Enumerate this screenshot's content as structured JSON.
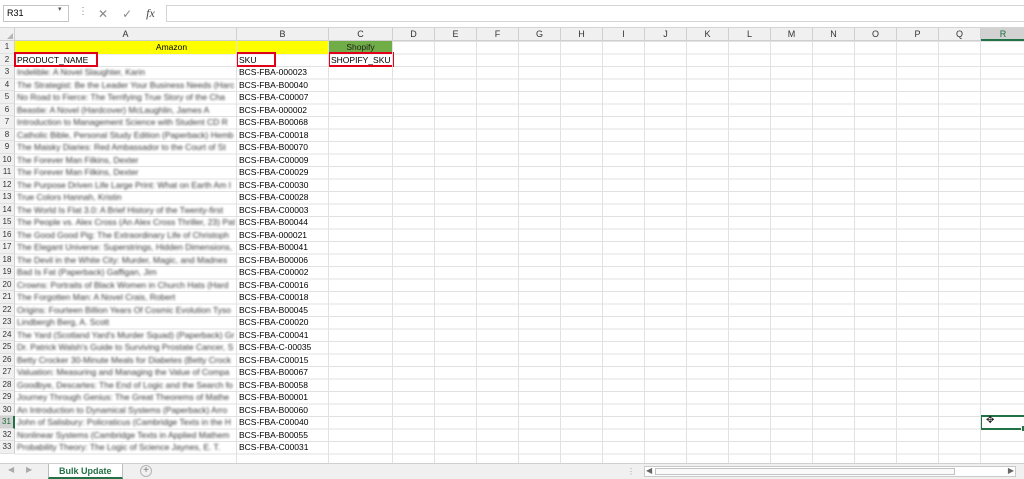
{
  "formula_bar": {
    "name_box": "R31",
    "formula_value": ""
  },
  "columns": [
    "A",
    "B",
    "C",
    "D",
    "E",
    "F",
    "G",
    "H",
    "I",
    "J",
    "K",
    "L",
    "M",
    "N",
    "O",
    "P",
    "Q",
    "R"
  ],
  "active_column": "R",
  "active_row": 31,
  "header_row": {
    "amazon_label": "Amazon",
    "shopify_label": "Shopify",
    "product_name_header": "PRODUCT_NAME",
    "sku_header": "SKU",
    "shopify_sku_header": "SHOPIFY_SKU"
  },
  "rows": [
    {
      "n": 3,
      "name": "Indelible: A Novel Slaughter, Karin",
      "sku": "BCS-FBA-000023"
    },
    {
      "n": 4,
      "name": "The Strategist: Be the Leader Your Business Needs (Harc",
      "sku": "BCS-FBA-B00040"
    },
    {
      "n": 5,
      "name": "No Road to Fierce: The Terrifying True Story of the Cha",
      "sku": "BCS-FBA-C00007"
    },
    {
      "n": 6,
      "name": "Beastie: A Novel (Hardcover) McLaughlin, James A",
      "sku": "BCS-FBA-000002"
    },
    {
      "n": 7,
      "name": "Introduction to Management Science with Student CD R",
      "sku": "BCS-FBA-B00068"
    },
    {
      "n": 8,
      "name": "Catholic Bible, Personal Study Edition (Paperback) Hemb",
      "sku": "BCS-FBA-C00018"
    },
    {
      "n": 9,
      "name": "The Maisky Diaries: Red Ambassador to the Court of St",
      "sku": "BCS-FBA-B00070"
    },
    {
      "n": 10,
      "name": "The Forever Man Filkins, Dexter",
      "sku": "BCS-FBA-C00009"
    },
    {
      "n": 11,
      "name": "The Forever Man Filkins, Dexter",
      "sku": "BCS-FBA-C00029"
    },
    {
      "n": 12,
      "name": "The Purpose Driven Life Large Print: What on Earth Am I",
      "sku": "BCS-FBA-C00030"
    },
    {
      "n": 13,
      "name": "True Colors Hannah, Kristin",
      "sku": "BCS-FBA-C00028"
    },
    {
      "n": 14,
      "name": "The World Is Flat 3.0: A Brief History of the Twenty-first",
      "sku": "BCS-FBA-C00003"
    },
    {
      "n": 15,
      "name": "The People vs. Alex Cross (An Alex Cross Thriller, 23) Pat",
      "sku": "BCS-FBA-B00044"
    },
    {
      "n": 16,
      "name": "The Good Good Pig: The Extraordinary Life of Christoph",
      "sku": "BCS-FBA-000021"
    },
    {
      "n": 17,
      "name": "The Elegant Universe: Superstrings, Hidden Dimensions,",
      "sku": "BCS-FBA-B00041"
    },
    {
      "n": 18,
      "name": "The Devil in the White City: Murder, Magic, and Madnes",
      "sku": "BCS-FBA-B00006"
    },
    {
      "n": 19,
      "name": "Bad Is Fat (Paperback) Gaffigan, Jim",
      "sku": "BCS-FBA-C00002"
    },
    {
      "n": 20,
      "name": "Crowns: Portraits of Black Women in Church Hats (Hard",
      "sku": "BCS-FBA-C00016"
    },
    {
      "n": 21,
      "name": "The Forgotten Man: A Novel Crais, Robert",
      "sku": "BCS-FBA-C00018"
    },
    {
      "n": 22,
      "name": "Origins: Fourteen Billion Years Of Cosmic Evolution Tyso",
      "sku": "BCS-FBA-B00045"
    },
    {
      "n": 23,
      "name": "Lindbergh Berg, A. Scott",
      "sku": "BCS-FBA-C00020"
    },
    {
      "n": 24,
      "name": "The Yard (Scotland Yard's Murder Squad) (Paperback) Gr",
      "sku": "BCS-FBA-C00041"
    },
    {
      "n": 25,
      "name": "Dr. Patrick Walsh's Guide to Surviving Prostate Cancer, S",
      "sku": "BCS-FBA-C-00035"
    },
    {
      "n": 26,
      "name": "Betty Crocker 30-Minute Meals for Diabetes (Betty Crock",
      "sku": "BCS-FBA-C00015"
    },
    {
      "n": 27,
      "name": "Valuation: Measuring and Managing the Value of Compa",
      "sku": "BCS-FBA-B00067"
    },
    {
      "n": 28,
      "name": "Goodbye, Descartes: The End of Logic and the Search fo",
      "sku": "BCS-FBA-B00058"
    },
    {
      "n": 29,
      "name": "Journey Through Genius: The Great Theorems of Mathe",
      "sku": "BCS-FBA-B00001"
    },
    {
      "n": 30,
      "name": "An Introduction to Dynamical Systems (Paperback) Arro",
      "sku": "BCS-FBA-B00060"
    },
    {
      "n": 31,
      "name": "John of Salisbury: Policraticus (Cambridge Texts in the H",
      "sku": "BCS-FBA-C00040"
    },
    {
      "n": 32,
      "name": "Nonlinear Systems (Cambridge Texts in Applied Mathem",
      "sku": "BCS-FBA-B00055"
    },
    {
      "n": 33,
      "name": "Probability Theory: The Logic of Science Jaynes, E. T.",
      "sku": "BCS-FBA-C00031"
    }
  ],
  "sheet_tab": "Bulk Update",
  "colors": {
    "amazon_fill": "#ffff00",
    "shopify_fill": "#70ad47",
    "highlight_box": "#e0001b",
    "excel_green": "#217346"
  }
}
